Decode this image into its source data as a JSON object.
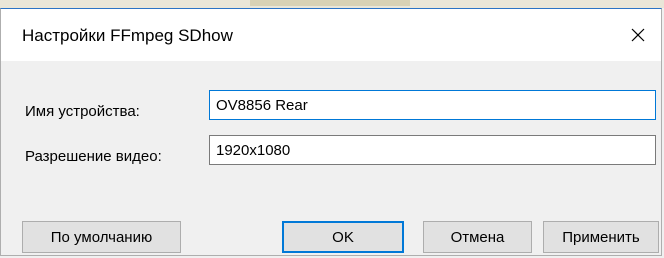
{
  "dialog": {
    "title": "Настройки FFmpeg SDhow",
    "close_icon": "close-icon"
  },
  "fields": {
    "device_name": {
      "label": "Имя устройства:",
      "value": "OV8856 Rear"
    },
    "video_resolution": {
      "label": "Разрешение видео:",
      "value": "1920x1080"
    }
  },
  "buttons": {
    "defaults": "По умолчанию",
    "ok": "OK",
    "cancel": "Отмена",
    "apply": "Применить"
  },
  "colors": {
    "accent": "#0078d7",
    "dialog_background": "#f0f0f0",
    "button_background": "#e1e1e1"
  }
}
